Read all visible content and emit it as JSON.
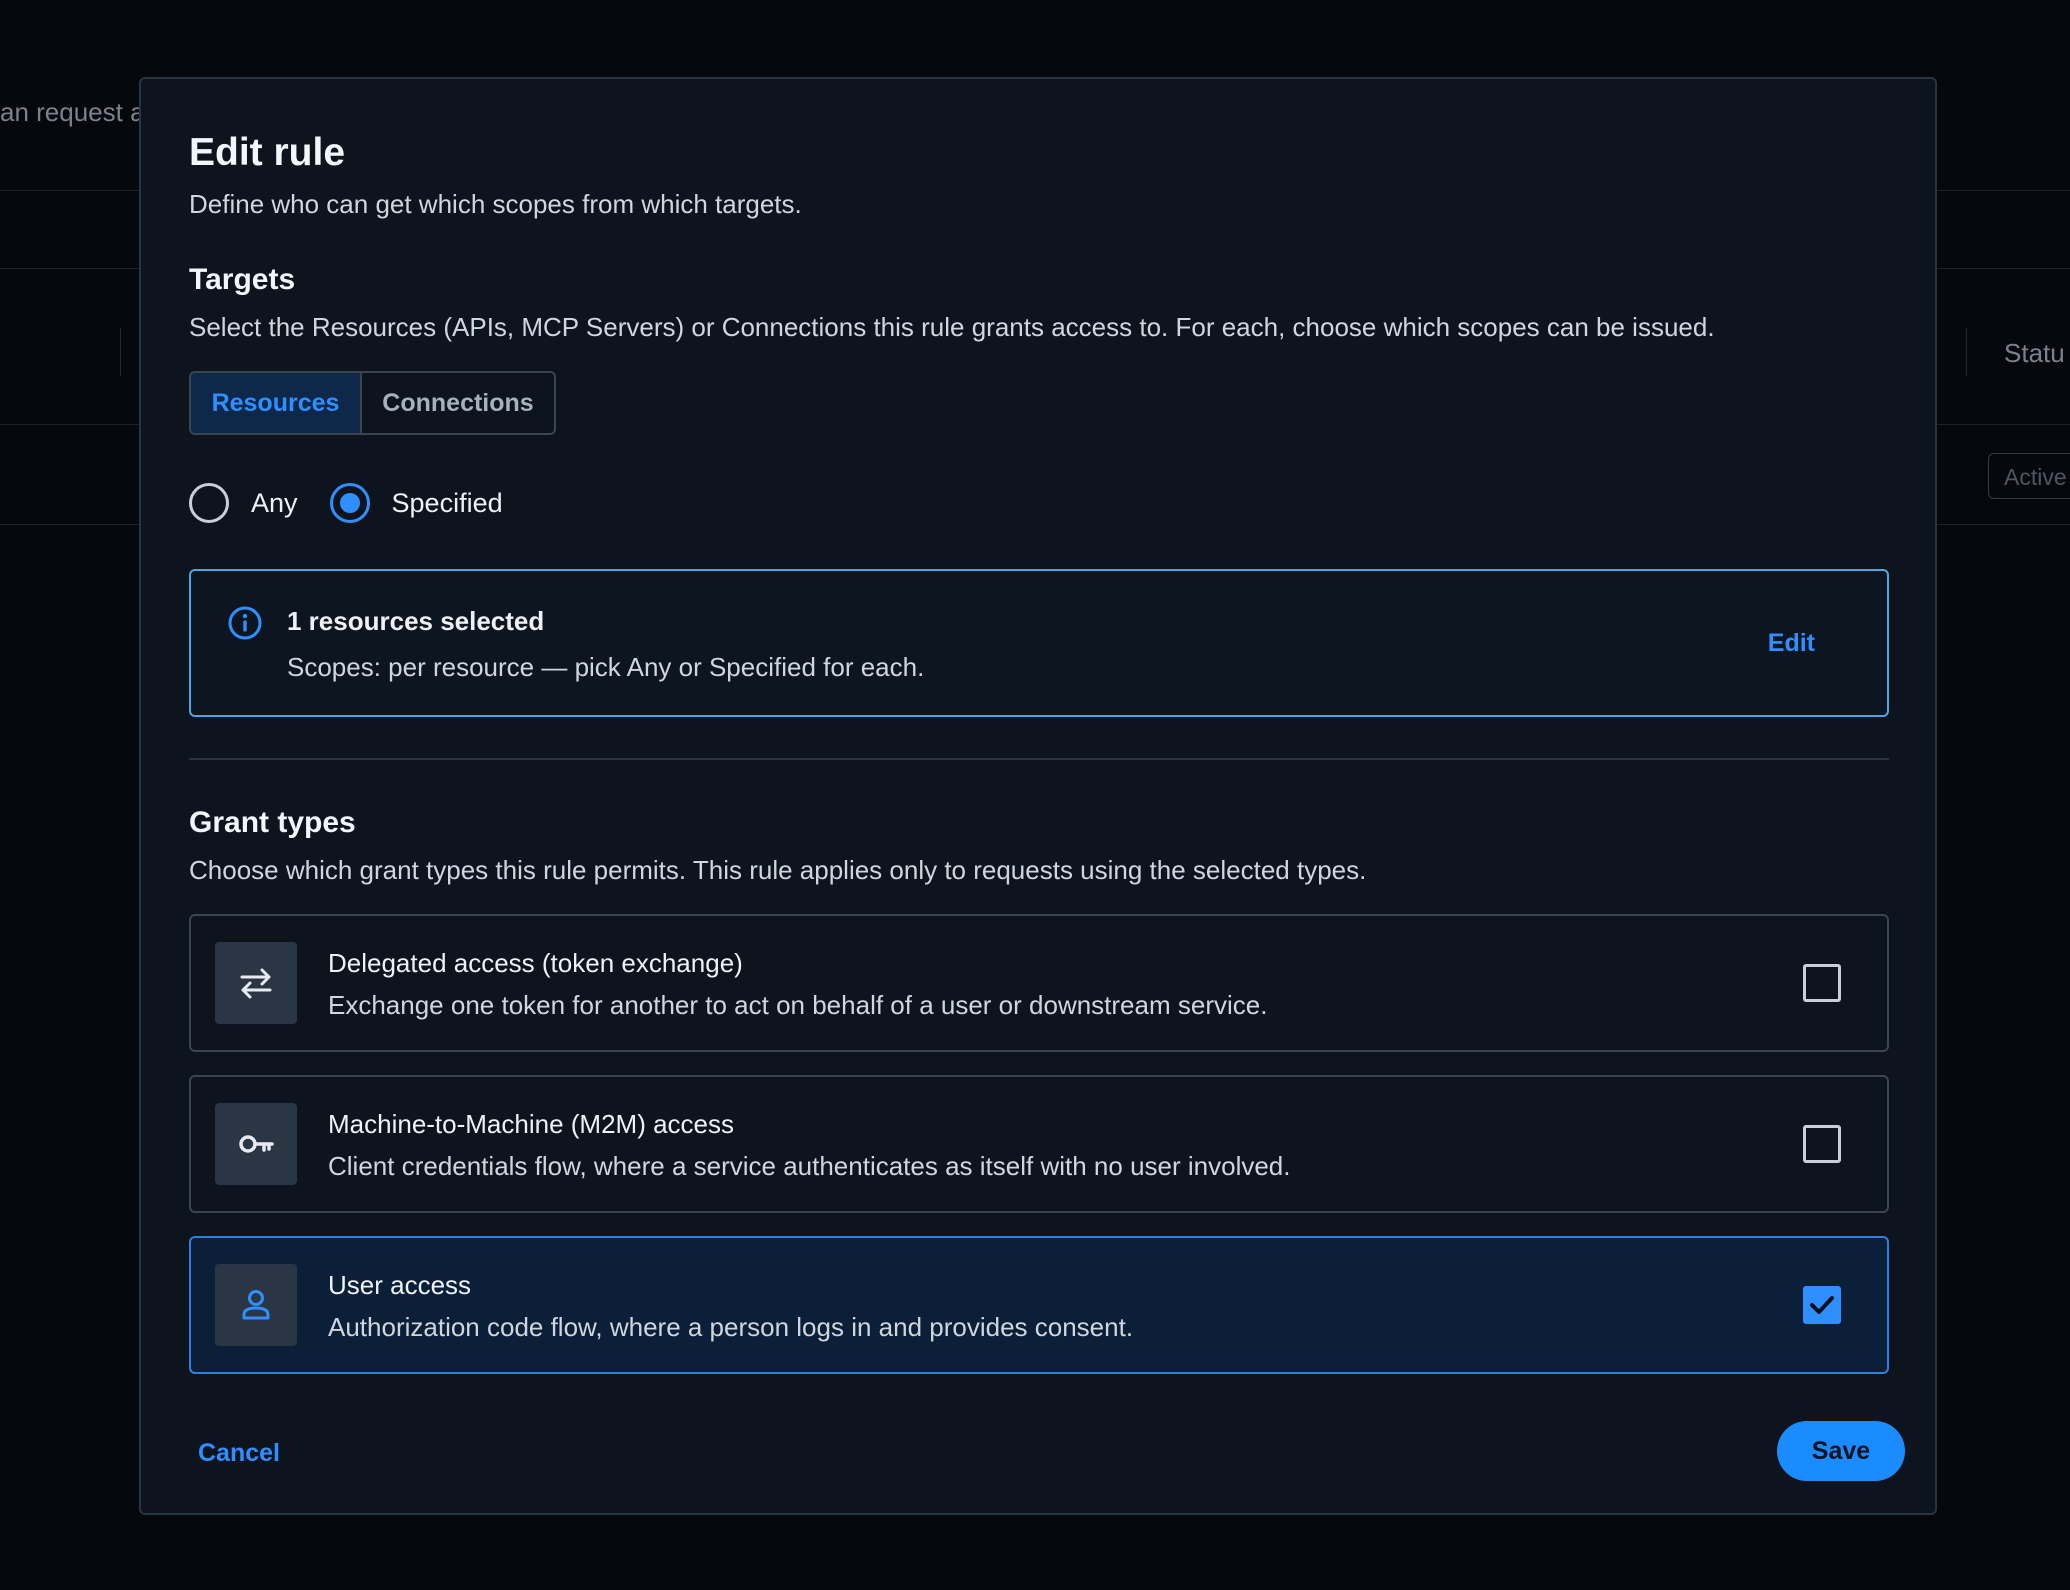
{
  "background": {
    "fragment_text": "an request a",
    "column_header": "Statu",
    "badge": "Active"
  },
  "modal": {
    "title": "Edit rule",
    "subtitle": "Define who can get which scopes from which targets."
  },
  "targets": {
    "title": "Targets",
    "description": "Select the Resources (APIs, MCP Servers) or Connections this rule grants access to. For each, choose which scopes can be issued.",
    "tabs": [
      {
        "label": "Resources",
        "active": true
      },
      {
        "label": "Connections",
        "active": false
      }
    ],
    "radios": [
      {
        "label": "Any",
        "checked": false
      },
      {
        "label": "Specified",
        "checked": true
      }
    ],
    "info": {
      "icon": "info-icon",
      "title": "1 resources selected",
      "description": "Scopes: per resource — pick Any or Specified for each.",
      "edit_label": "Edit"
    }
  },
  "grant_types": {
    "title": "Grant types",
    "description": "Choose which grant types this rule permits. This rule applies only to requests using the selected types.",
    "items": [
      {
        "icon": "swap-arrows-icon",
        "title": "Delegated access (token exchange)",
        "description": "Exchange one token for another to act on behalf of a user or downstream service.",
        "checked": false
      },
      {
        "icon": "key-icon",
        "title": "Machine-to-Machine (M2M) access",
        "description": "Client credentials flow, where a service authenticates as itself with no user involved.",
        "checked": false
      },
      {
        "icon": "user-icon",
        "title": "User access",
        "description": "Authorization code flow, where a person logs in and provides consent.",
        "checked": true
      }
    ]
  },
  "footer": {
    "cancel_label": "Cancel",
    "save_label": "Save"
  },
  "colors": {
    "accent": "#2f8fff",
    "modal_bg": "#0e141e",
    "selected_card_bg": "#0c1f38",
    "info_border": "#4aa6e6"
  }
}
